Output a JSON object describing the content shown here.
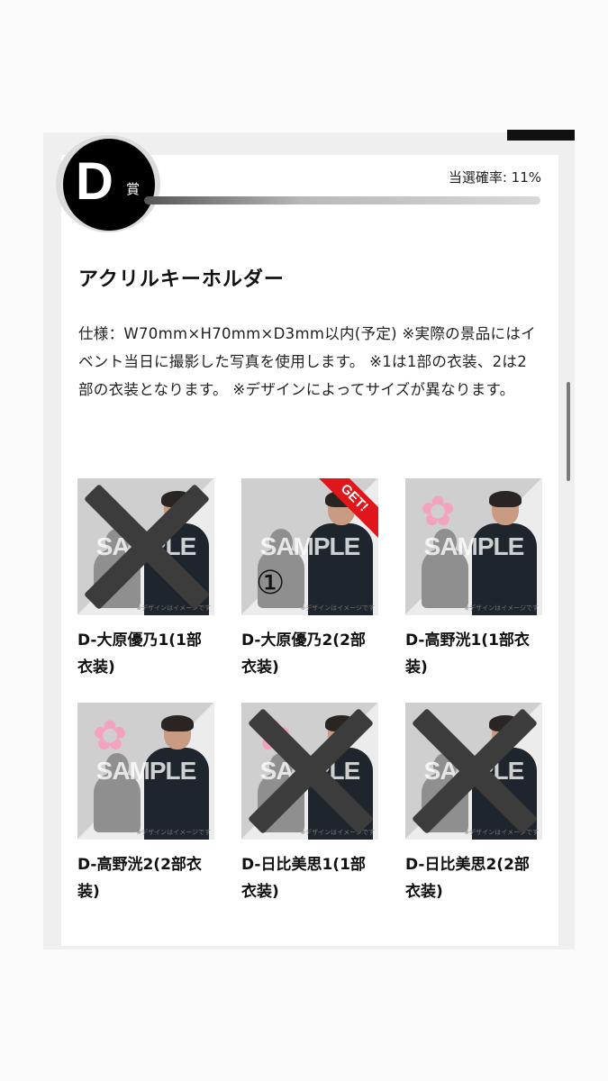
{
  "prize": {
    "letter": "D",
    "suffix": "賞",
    "probability_label": "当選確率: 11%",
    "probability_value": 0.11,
    "title": "アクリルキーホルダー",
    "description": "仕様：W70mm×H70mm×D3mm以内(予定) ※実際の景品にはイベント当日に撮影した写真を使用します。 ※1は1部の衣装、2は2部の衣装となります。 ※デザインによってサイズが異なります。"
  },
  "items": [
    {
      "label": "D-大原優乃1(1部衣装)",
      "get_badge": "",
      "crossed": true,
      "flower": false,
      "circle": ""
    },
    {
      "label": "D-大原優乃2(2部衣装)",
      "get_badge": "GET!",
      "crossed": false,
      "flower": false,
      "circle": "①"
    },
    {
      "label": "D-高野洸1(1部衣装)",
      "get_badge": "",
      "crossed": false,
      "flower": true,
      "circle": ""
    },
    {
      "label": "D-高野洸2(2部衣装)",
      "get_badge": "",
      "crossed": false,
      "flower": true,
      "circle": ""
    },
    {
      "label": "D-日比美思1(1部衣装)",
      "get_badge": "",
      "crossed": true,
      "flower": true,
      "circle": ""
    },
    {
      "label": "D-日比美思2(2部衣装)",
      "get_badge": "",
      "crossed": true,
      "flower": false,
      "circle": ""
    }
  ],
  "thumb_text": {
    "watermark": "SAMPLE",
    "note": "※デザインはイメージです"
  }
}
